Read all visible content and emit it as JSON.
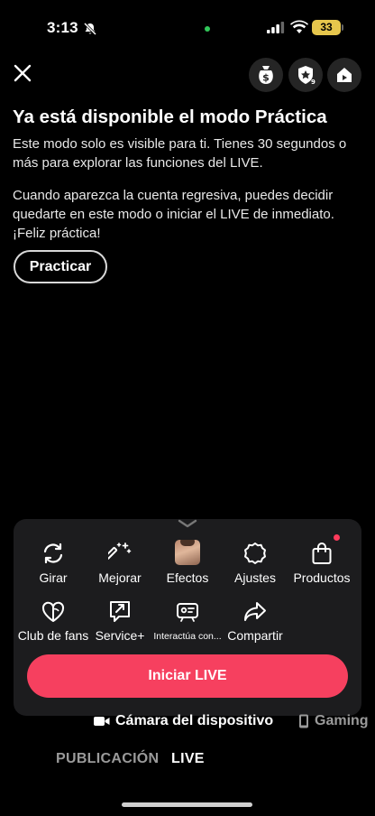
{
  "status_bar": {
    "time": "3:13",
    "battery": "33",
    "icons": [
      "bell-off-icon",
      "cellular-signal-icon",
      "wifi-icon",
      "battery-icon"
    ]
  },
  "top_bar": {
    "close_icon": "close-icon",
    "actions": [
      "dollar-bag-icon",
      "shield-star-icon",
      "home-icon"
    ]
  },
  "intro": {
    "title": "Ya está disponible el modo Práctica",
    "paragraph1": "Este modo solo es visible para ti. Tienes 30 segundos o más para explorar las funciones del LIVE.",
    "paragraph2": "Cuando aparezca la cuenta regresiva, puedes decidir quedarte en este modo o iniciar el LIVE de inmediato. ¡Feliz práctica!",
    "practice_button": "Practicar"
  },
  "tools": {
    "row1": [
      {
        "label": "Girar",
        "icon": "rotate-icon"
      },
      {
        "label": "Mejorar",
        "icon": "magic-wand-icon"
      },
      {
        "label": "Efectos",
        "icon": "effects-avatar"
      },
      {
        "label": "Ajustes",
        "icon": "settings-gear-icon"
      },
      {
        "label": "Productos",
        "icon": "shopping-bag-icon"
      }
    ],
    "row2": [
      {
        "label": "Club de fans",
        "icon": "heart-icon"
      },
      {
        "label": "Service+",
        "icon": "service-plus-icon"
      },
      {
        "label": "Interactúa con...",
        "icon": "interact-icon"
      },
      {
        "label": "Compartir",
        "icon": "share-arrow-icon"
      }
    ]
  },
  "start_button": "Iniciar LIVE",
  "sources": [
    {
      "label": "Cámara del dispositivo",
      "icon": "camera-icon",
      "active": true
    },
    {
      "label": "Gaming",
      "icon": "phone-icon",
      "active": false
    }
  ],
  "modes": [
    {
      "label": "PUBLICACIÓN",
      "active": false
    },
    {
      "label": "LIVE",
      "active": true
    }
  ],
  "colors": {
    "accent": "#f6405f",
    "panel": "#1c1c1e",
    "battery": "#e6c64c"
  }
}
